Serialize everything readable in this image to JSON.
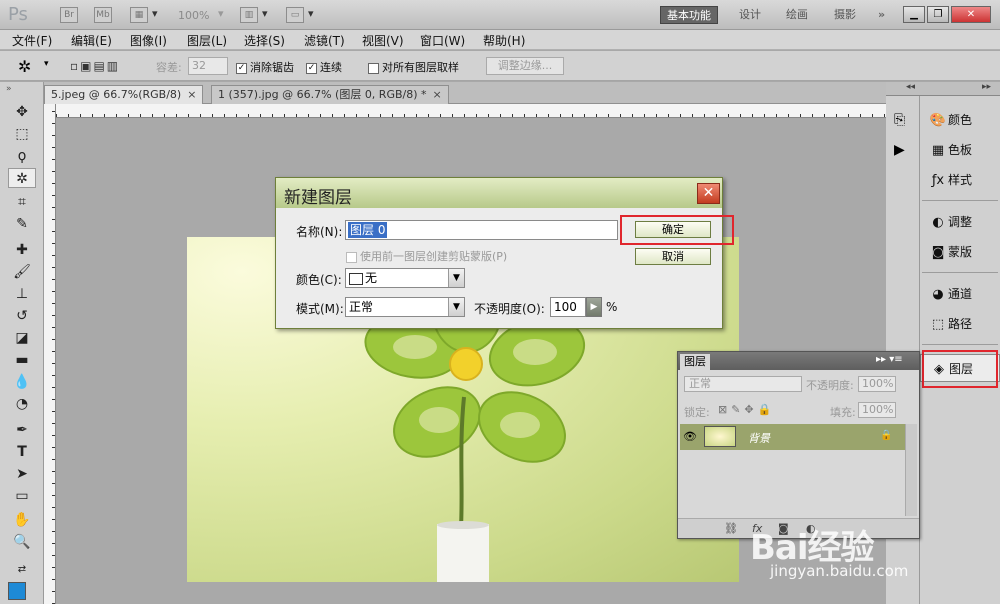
{
  "appbar": {
    "logo": "Ps",
    "zoom": "100%",
    "workspaces": [
      "基本功能",
      "设计",
      "绘画",
      "摄影"
    ],
    "more": "»"
  },
  "menubar": [
    "文件(F)",
    "编辑(E)",
    "图像(I)",
    "图层(L)",
    "选择(S)",
    "滤镜(T)",
    "视图(V)",
    "窗口(W)",
    "帮助(H)"
  ],
  "options": {
    "tolerance_label": "容差:",
    "tolerance_value": "32",
    "antialias": "消除锯齿",
    "contiguous": "连续",
    "sample_all": "对所有图层取样",
    "refine_edge": "调整边缘..."
  },
  "tabs": [
    {
      "label": "5.jpeg @ 66.7%(RGB/8)"
    },
    {
      "label": "1 (357).jpg @ 66.7% (图层 0, RGB/8) *"
    }
  ],
  "dialog": {
    "title": "新建图层",
    "name_label": "名称(N):",
    "name_value": "图层 0",
    "clip_label": "使用前一图层创建剪贴蒙版(P)",
    "color_label": "颜色(C):",
    "color_value": "无",
    "mode_label": "模式(M):",
    "mode_value": "正常",
    "opacity_label": "不透明度(O):",
    "opacity_value": "100",
    "opacity_unit": "%",
    "ok": "确定",
    "cancel": "取消"
  },
  "right_panels": [
    "颜色",
    "色板",
    "样式",
    "调整",
    "蒙版",
    "通道",
    "路径",
    "图层"
  ],
  "layers_panel": {
    "title": "图层",
    "blend": "正常",
    "opacity_label": "不透明度:",
    "opacity_value": "100%",
    "lock_label": "锁定:",
    "fill_label": "填充:",
    "fill_value": "100%",
    "layer_name": "背景"
  },
  "watermark": {
    "logo": "Bai经验",
    "url": "jingyan.baidu.com"
  }
}
